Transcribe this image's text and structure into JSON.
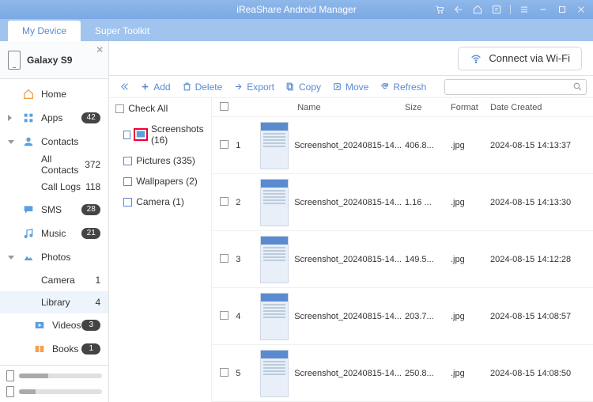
{
  "window": {
    "title": "iReaShare Android Manager"
  },
  "tabs": {
    "my_device": "My Device",
    "super_toolkit": "Super Toolkit"
  },
  "device": {
    "name": "Galaxy S9"
  },
  "nav": {
    "home": "Home",
    "apps": "Apps",
    "apps_count": "42",
    "contacts": "Contacts",
    "all_contacts": "All Contacts",
    "all_contacts_count": "372",
    "call_logs": "Call Logs",
    "call_logs_count": "118",
    "sms": "SMS",
    "sms_count": "28",
    "music": "Music",
    "music_count": "21",
    "photos": "Photos",
    "camera": "Camera",
    "camera_count": "1",
    "library": "Library",
    "library_count": "4",
    "videos": "Videos",
    "videos_count": "3",
    "books": "Books",
    "books_count": "1"
  },
  "actions": {
    "connect_wifi": "Connect via Wi-Fi"
  },
  "toolbar": {
    "add": "Add",
    "delete": "Delete",
    "export": "Export",
    "copy": "Copy",
    "move": "Move",
    "refresh": "Refresh"
  },
  "folders": {
    "check_all": "Check All",
    "screenshots": "Screenshots (16)",
    "pictures": "Pictures (335)",
    "wallpapers": "Wallpapers (2)",
    "camera": "Camera (1)"
  },
  "columns": {
    "name": "Name",
    "size": "Size",
    "format": "Format",
    "date": "Date Created"
  },
  "rows": [
    {
      "num": "1",
      "name": "Screenshot_20240815-14...",
      "size": "406.8...",
      "fmt": ".jpg",
      "date": "2024-08-15 14:13:37"
    },
    {
      "num": "2",
      "name": "Screenshot_20240815-14...",
      "size": "1.16 ...",
      "fmt": ".jpg",
      "date": "2024-08-15 14:13:30"
    },
    {
      "num": "3",
      "name": "Screenshot_20240815-14...",
      "size": "149.5...",
      "fmt": ".jpg",
      "date": "2024-08-15 14:12:28"
    },
    {
      "num": "4",
      "name": "Screenshot_20240815-14...",
      "size": "203.7...",
      "fmt": ".jpg",
      "date": "2024-08-15 14:08:57"
    },
    {
      "num": "5",
      "name": "Screenshot_20240815-14...",
      "size": "250.8...",
      "fmt": ".jpg",
      "date": "2024-08-15 14:08:50"
    }
  ]
}
